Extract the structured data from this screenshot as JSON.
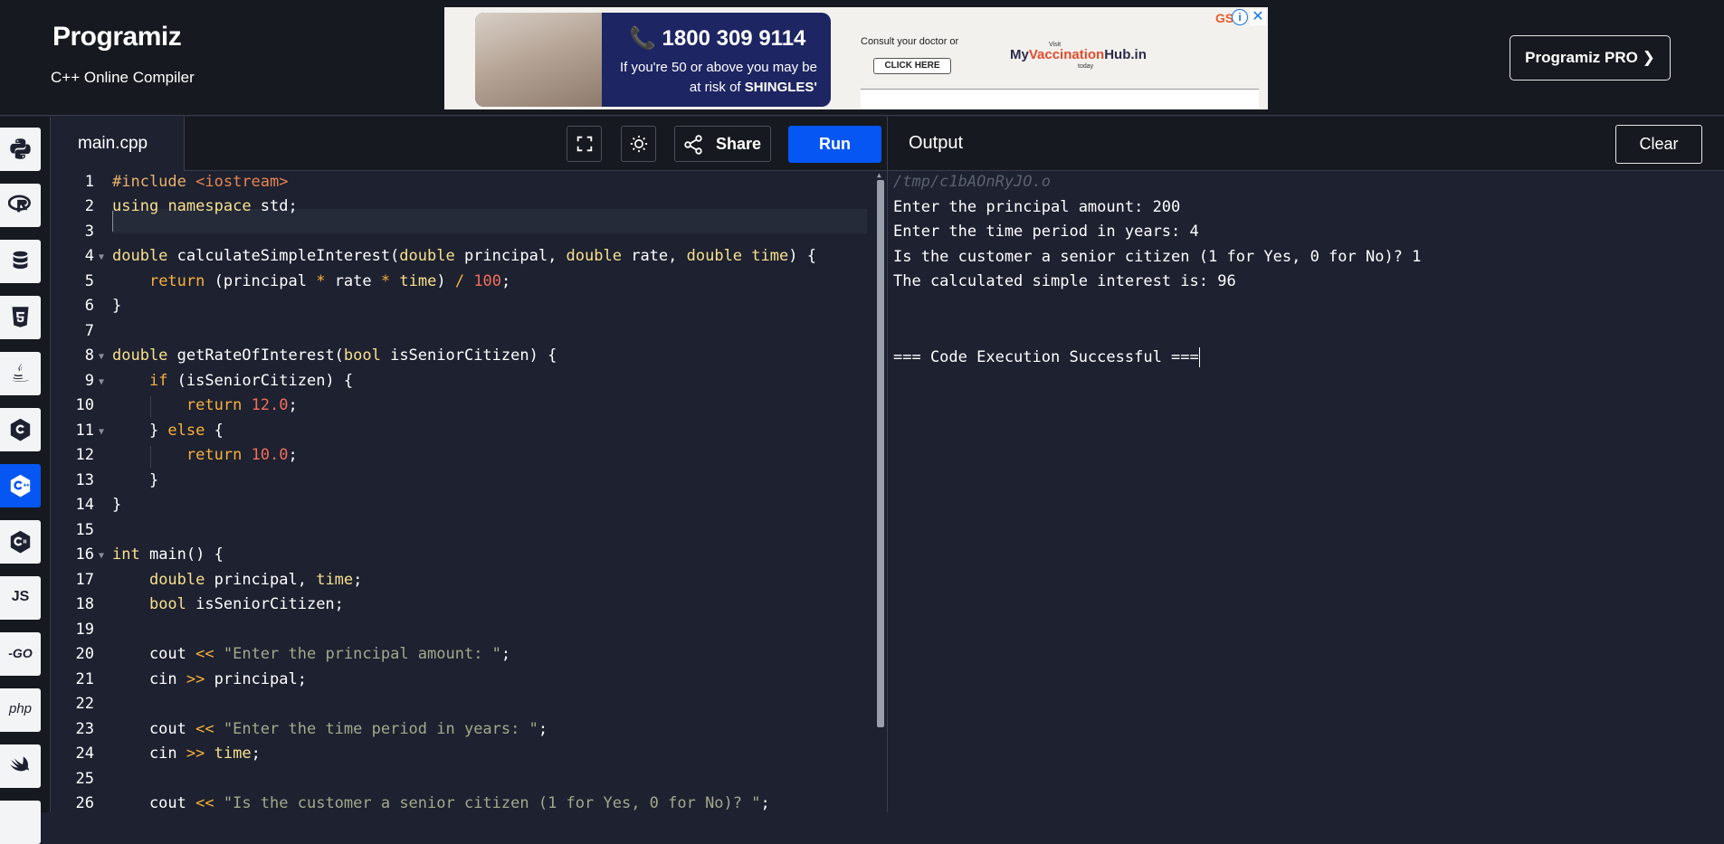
{
  "header": {
    "logo_text": "Programiz",
    "subtitle": "C++ Online Compiler",
    "pro_button": "Programiz PRO ❯"
  },
  "ad": {
    "phone": "📞 1800 309 9114",
    "line2": "If you're 50 or above you may be",
    "line3_prefix": "at risk of ",
    "line3_bold": "SHINGLES'",
    "consult": "Consult your doctor or",
    "click": "CLICK HERE",
    "visit": "Visit",
    "hub_a": "My",
    "hub_b": "Vaccination",
    "hub_c": "Hub.in",
    "today": "today",
    "corner": "GSK",
    "info": "i",
    "close": "✕"
  },
  "sidebar": {
    "items": [
      {
        "name": "python",
        "icon": "python-icon"
      },
      {
        "name": "r",
        "icon": "r-icon"
      },
      {
        "name": "sql",
        "icon": "database-icon"
      },
      {
        "name": "html",
        "icon": "html5-icon"
      },
      {
        "name": "java",
        "icon": "java-icon"
      },
      {
        "name": "c",
        "icon": "c-icon"
      },
      {
        "name": "cpp",
        "icon": "cpp-icon",
        "active": true
      },
      {
        "name": "csharp",
        "icon": "csharp-icon"
      },
      {
        "name": "js",
        "label": "JS"
      },
      {
        "name": "go",
        "label": "-GO"
      },
      {
        "name": "php",
        "label": "php"
      },
      {
        "name": "swift",
        "icon": "swift-icon"
      }
    ]
  },
  "editor": {
    "file_name": "main.cpp",
    "share_label": "Share",
    "run_label": "Run",
    "line_numbers": [
      "1",
      "2",
      "3",
      "4",
      "5",
      "6",
      "7",
      "8",
      "9",
      "10",
      "11",
      "12",
      "13",
      "14",
      "15",
      "16",
      "17",
      "18",
      "19",
      "20",
      "21",
      "22",
      "23",
      "24",
      "25",
      "26"
    ]
  },
  "output": {
    "title": "Output",
    "clear_label": "Clear",
    "path": "/tmp/c1bAOnRyJO.o",
    "lines": [
      "Enter the principal amount: 200",
      "Enter the time period in years: 4",
      "Is the customer a senior citizen (1 for Yes, 0 for No)? 1",
      "The calculated simple interest is: 96",
      "",
      "",
      "=== Code Execution Successful ==="
    ]
  },
  "colors": {
    "accent": "#0556f3",
    "background": "#1d2130",
    "header": "#16191f"
  }
}
